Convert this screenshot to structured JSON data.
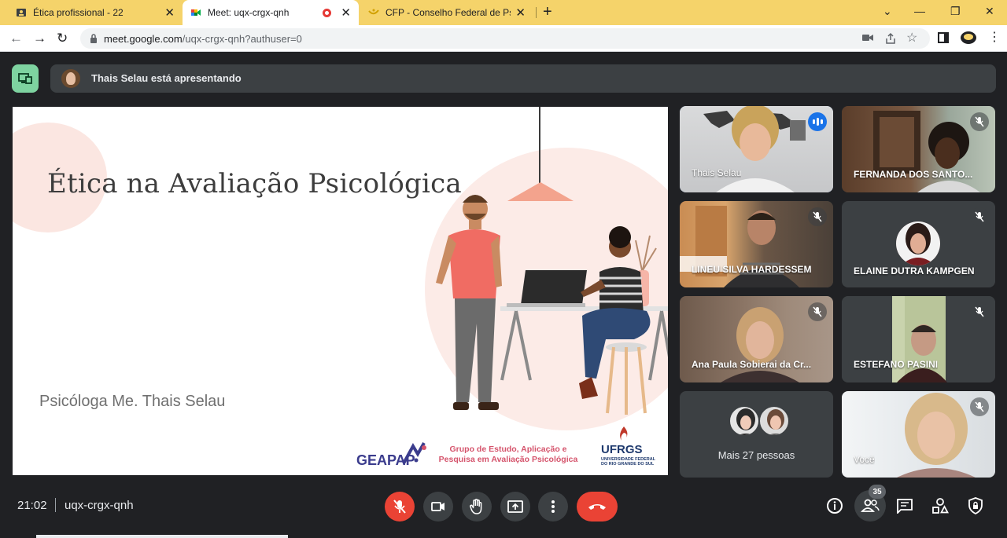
{
  "browser": {
    "tabs": [
      {
        "title": "Ética profissional - 22",
        "active": false
      },
      {
        "title": "Meet: uqx-crgx-qnh",
        "active": true
      },
      {
        "title": "CFP - Conselho Federal de Psicol",
        "active": false
      }
    ],
    "url_host": "meet.google.com",
    "url_path": "/uqx-crgx-qnh?authuser=0",
    "new_tab_label": "+",
    "tab_close_label": "✕"
  },
  "presenter": {
    "banner_text": "Thais Selau está apresentando"
  },
  "slide": {
    "title": "Ética na Avaliação Psicológica",
    "author": "Psicóloga Me. Thais Selau",
    "logo_geapap": "GEAPAP",
    "group_name": "Grupo de Estudo, Aplicação e Pesquisa em Avaliação Psicológica",
    "logo_ufrgs": "UFRGS",
    "ufrgs_subtitle": "UNIVERSIDADE FEDERAL DO RIO GRANDE DO SUL"
  },
  "participants": [
    {
      "name": "Thais Selau",
      "speaking": true,
      "muted": false
    },
    {
      "name": "FERNANDA DOS SANTO...",
      "speaking": false,
      "muted": true
    },
    {
      "name": "LINEU SILVA HARDESSEM",
      "speaking": false,
      "muted": true
    },
    {
      "name": "ELAINE DUTRA KAMPGEN",
      "speaking": false,
      "muted": true
    },
    {
      "name": "Ana Paula Sobierai da Cr...",
      "speaking": false,
      "muted": true
    },
    {
      "name": "ESTEFANO PASINI",
      "speaking": false,
      "muted": true
    },
    {
      "name": "Mais 27 pessoas"
    },
    {
      "name": "Você",
      "speaking": false,
      "muted": true
    }
  ],
  "toolbar": {
    "time": "21:02",
    "meeting_code": "uqx-crgx-qnh",
    "people_count": "35"
  },
  "colors": {
    "tab_bar": "#f5d36a",
    "meet_bg": "#202124",
    "accent_blue": "#8ab4f8",
    "danger_red": "#ea4335",
    "present_green": "#7ed3a0"
  }
}
